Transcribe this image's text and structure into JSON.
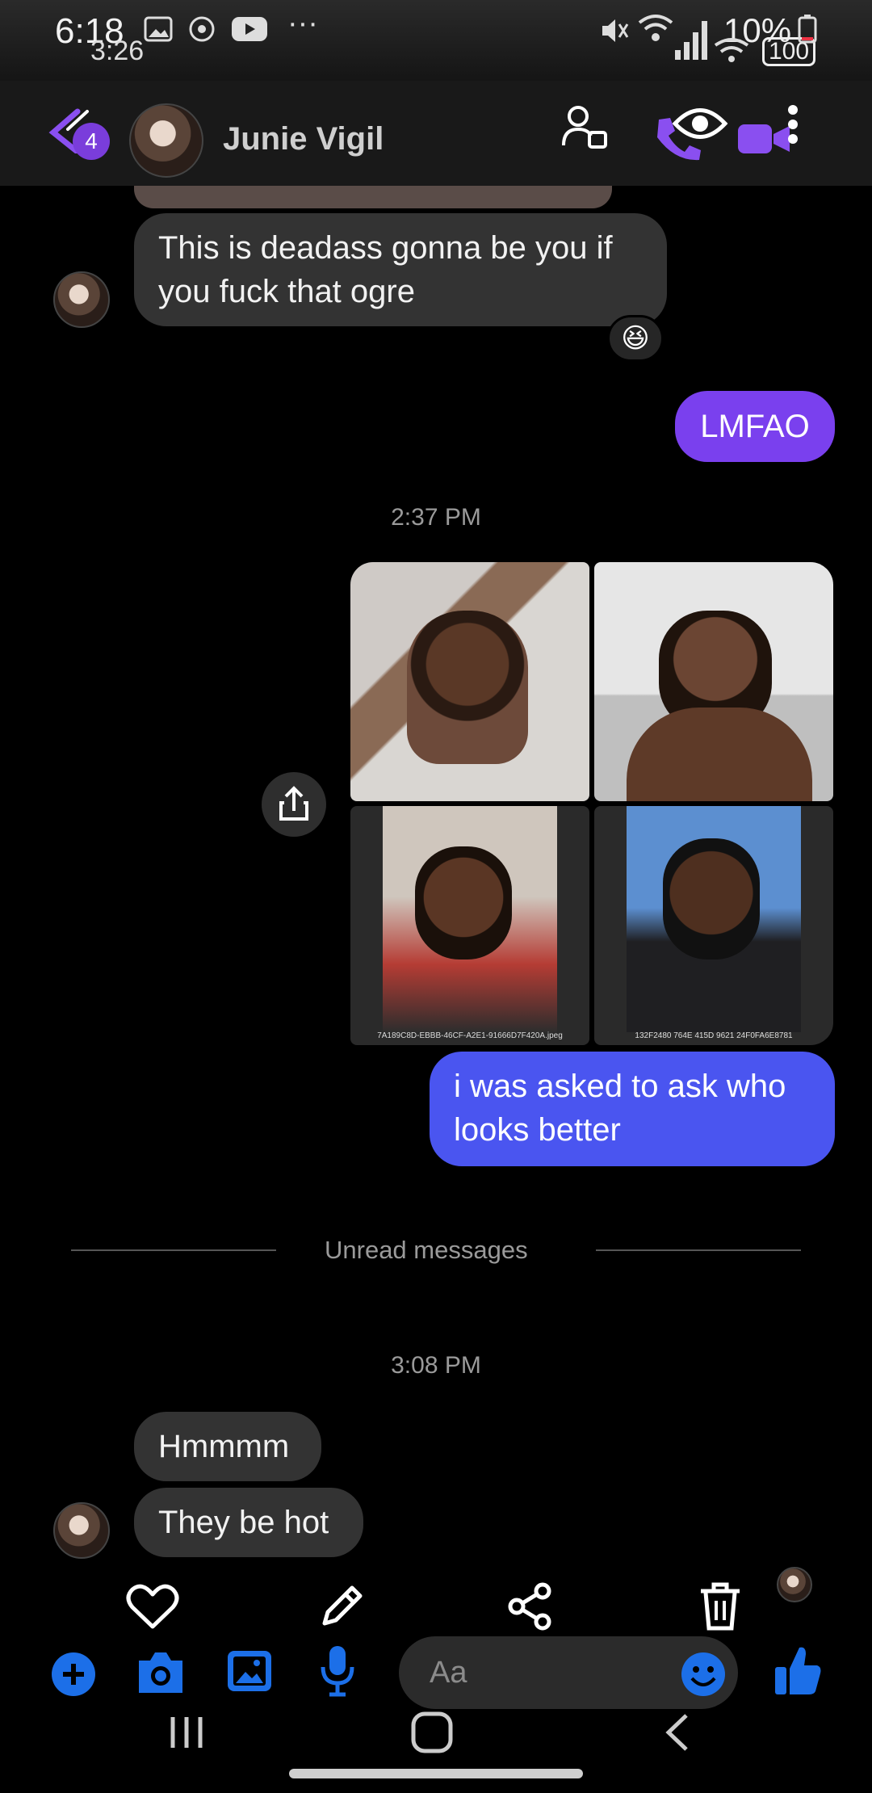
{
  "status": {
    "time": "6:18",
    "time_secondary": "3:26",
    "dots": "···",
    "battery_pct": "10%",
    "battery_secondary": "100"
  },
  "header": {
    "contact_name": "Junie Vigil",
    "badge_count": "4"
  },
  "messages": {
    "m1": "This is deadass gonna be you if you fuck that ogre",
    "m1_reaction": "😆",
    "m2": "LMFAO",
    "time1": "2:37 PM",
    "photo_captions": [
      "7A189C8D-EBBB-46CF-A2E1-91666D7F420A.jpeg",
      "132F2480 764E 415D 9621 24F0FA6E8781"
    ],
    "m3": "i was asked to ask who looks better",
    "unread_label": "Unread messages",
    "time2": "3:08 PM",
    "m4": "Hmmmm",
    "m5": "They be hot"
  },
  "composer": {
    "placeholder": "Aa"
  },
  "colors": {
    "accent_purple": "#7a40ee",
    "accent_blue": "#1c6fe8",
    "bubble_in": "#333333",
    "bubble_out_blue": "#4a55f0"
  },
  "icons": {
    "header": [
      "back-arrow-icon",
      "person-icon",
      "phone-icon",
      "eye-icon",
      "video-icon",
      "more-vertical-icon"
    ],
    "actions": [
      "heart-icon",
      "pencil-icon",
      "share-icon",
      "trash-icon"
    ],
    "composer": [
      "plus-icon",
      "camera-icon",
      "image-icon",
      "microphone-icon",
      "emoji-icon",
      "thumbs-up-icon"
    ],
    "nav": [
      "recents-icon",
      "home-icon",
      "back-icon"
    ]
  }
}
